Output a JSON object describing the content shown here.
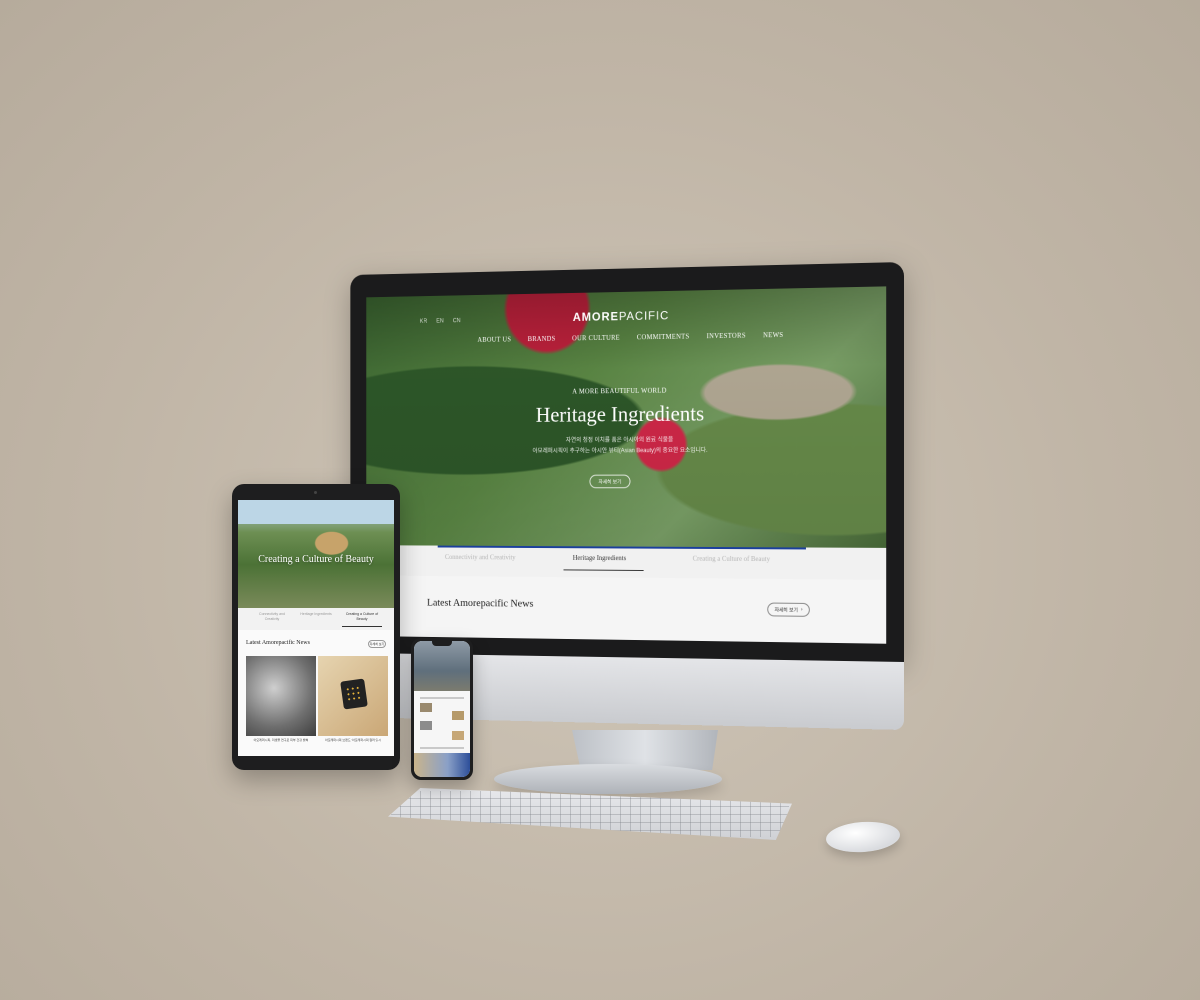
{
  "desktop": {
    "lang": [
      "KR",
      "EN",
      "CN"
    ],
    "logo_bold": "AMORE",
    "logo_light": "PACIFIC",
    "nav": [
      "ABOUT US",
      "BRANDS",
      "OUR CULTURE",
      "COMMITMENTS",
      "INVESTORS",
      "NEWS"
    ],
    "eyebrow": "A MORE BEAUTIFUL WORLD",
    "hero_title": "Heritage Ingredients",
    "hero_sub_1": "자연의 청정 이치를 품은 아시아의 원료 식물을",
    "hero_sub_2": "아모레퍼시픽이 추구하는 아시안 뷰티(Asian Beauty)의 중요한 요소입니다.",
    "hero_button": "자세히 보기",
    "tabs": [
      "Connectivity and Creativity",
      "Heritage Ingredients",
      "Creating a Culture of Beauty"
    ],
    "news_title": "Latest Amorepacific News",
    "news_button": "자세히 보기",
    "news_button_arrow": "›"
  },
  "tablet": {
    "hero_title": "Creating a Culture of Beauty",
    "tabs": [
      "Connectivity and Creativity",
      "Heritage Ingredients",
      "Creating a Culture of Beauty"
    ],
    "news_title": "Latest Amorepacific News",
    "news_button": "자세히 보기",
    "cards": [
      {
        "caption": "아모레퍼시픽, 미생물 연구로 피부 건강 밝혀"
      },
      {
        "caption": "아모레퍼시픽 브랜드 '아모레퍼시픽 컬러'출시"
      }
    ]
  }
}
